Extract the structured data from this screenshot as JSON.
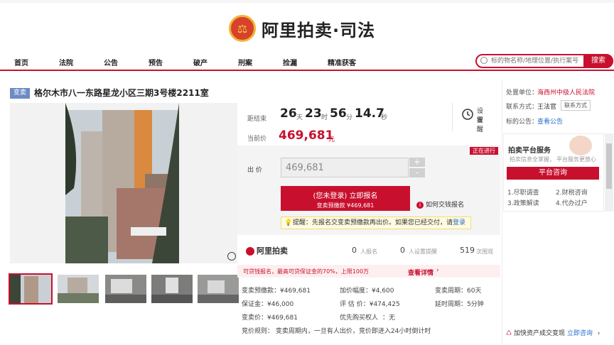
{
  "header": {
    "logo_text": "阿里拍卖·司法"
  },
  "nav": {
    "items": [
      "首页",
      "法院",
      "公告",
      "预告",
      "破产",
      "刑案",
      "捡漏",
      "精准获客"
    ]
  },
  "search": {
    "placeholder": "标的物名称/地理位置/执行案号",
    "button": "搜索"
  },
  "item": {
    "badge": "变卖",
    "title": "格尔木市八一东路星龙小区三期3号楼2211室",
    "countdown_label": "距结束",
    "countdown": {
      "days": "26",
      "days_unit": "天",
      "hours": "23",
      "hours_unit": "时",
      "minutes": "56",
      "minutes_unit": "分",
      "seconds": "14.7",
      "seconds_unit": "秒"
    },
    "price_label": "当前价",
    "price": "469,681",
    "price_unit": "元",
    "remind": {
      "line1": "设置",
      "line2": "提醒"
    },
    "status_tag": "正在进行",
    "bid_label": "出  价",
    "bid_value": "469,681",
    "plus": "+",
    "minus": "-",
    "signup_line1": "(您未登录) 立即报名",
    "signup_line2": "变卖预缴款 ¥469,681",
    "how_to_pay": "如何交钱报名",
    "tip_text": "提醒：先报名交变卖预缴款再出价。如果您已经交付，请",
    "tip_link": "登录"
  },
  "stats": {
    "brand": "阿里拍卖",
    "signups": "0",
    "signups_label": "人报名",
    "reminders": "0",
    "reminders_label": "人设置提醒",
    "views": "519",
    "views_label": "次围观"
  },
  "promo": {
    "text": "可贷钱报名，最高可贷保证金的70%，上限100万",
    "link": "查看详情"
  },
  "details": {
    "r1": [
      "变卖预缴款：¥469,681",
      "加价幅度：¥4,600",
      "变卖周期：60天"
    ],
    "r2": [
      "保证金：¥46,000",
      "评 估 价：¥474,425",
      "延时周期：5分钟"
    ],
    "r3": [
      "变卖价：¥469,681",
      "优先购买权人",
      "：无"
    ],
    "r4": "竞价规则：  变卖周期内，一旦有人出价，竞价即进入24小时倒计时"
  },
  "side": {
    "court_label": "处置单位：",
    "court": "海西州中级人民法院",
    "contact_label": "联系方式：",
    "contact": "王法官",
    "contact_btn": "联系方式",
    "notice_label": "标的公告：",
    "notice_link": "查看公告",
    "service_title": "拍卖平台服务",
    "service_sub1": "拍卖信息全掌握，",
    "service_sub2": "平台服务更放心",
    "consult_btn": "平台咨询",
    "services": [
      "1.尽职调查",
      "2.财税咨询",
      "3.政策解读",
      "4.代办过户"
    ],
    "footer_text": "加快资产成交变现",
    "footer_link": "立即咨询"
  },
  "colors": {
    "brand_red": "#c8102e",
    "badge_blue": "#6c8bc4"
  }
}
